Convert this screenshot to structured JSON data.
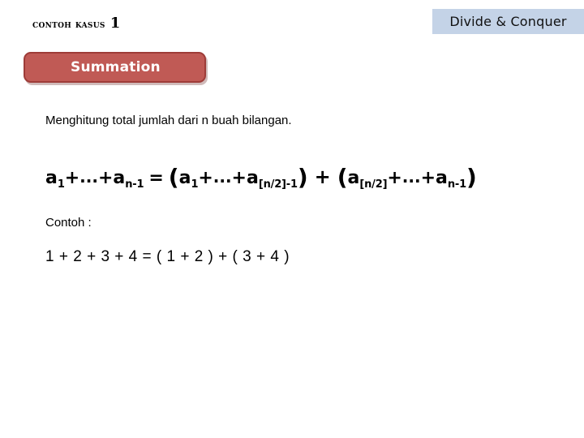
{
  "slide": {
    "topic_banner": {
      "label": "Divide & Conquer",
      "background_color": "#c4d3e7"
    },
    "case_header": {
      "label": "Contoh Kasus",
      "number": "1"
    },
    "summation_button": {
      "label": "Summation",
      "fill_color": "#c05a55",
      "border_color": "#9e3c38",
      "text_color": "#ffffff"
    },
    "body": {
      "description": "Menghitung total jumlah dari n buah bilangan.",
      "formula": {
        "lhs": {
          "first_term_base": "a",
          "first_term_sub": "1",
          "plus_1": "+",
          "ellipsis": "...",
          "plus_2": "+",
          "last_term_base": "a",
          "last_term_sub": "n-1"
        },
        "equals": "=",
        "group_left": {
          "open_paren": "(",
          "first_term_base": "a",
          "first_term_sub": "1",
          "plus_1": "+",
          "ellipsis": "...",
          "plus_2": "+",
          "last_term_base": "a",
          "last_term_sub": "[n/2]-1",
          "close_paren": ")"
        },
        "join_operator": "+",
        "group_right": {
          "open_paren": "(",
          "first_term_base": "a",
          "first_term_sub": "[n/2]",
          "plus_1": "+",
          "ellipsis": "...",
          "plus_2": "+",
          "last_term_base": "a",
          "last_term_sub": "n-1",
          "close_paren": ")"
        }
      },
      "example_label": "Contoh :",
      "example_expression": "1 + 2 + 3 + 4  =  ( 1 + 2 ) + ( 3 + 4 )"
    }
  }
}
